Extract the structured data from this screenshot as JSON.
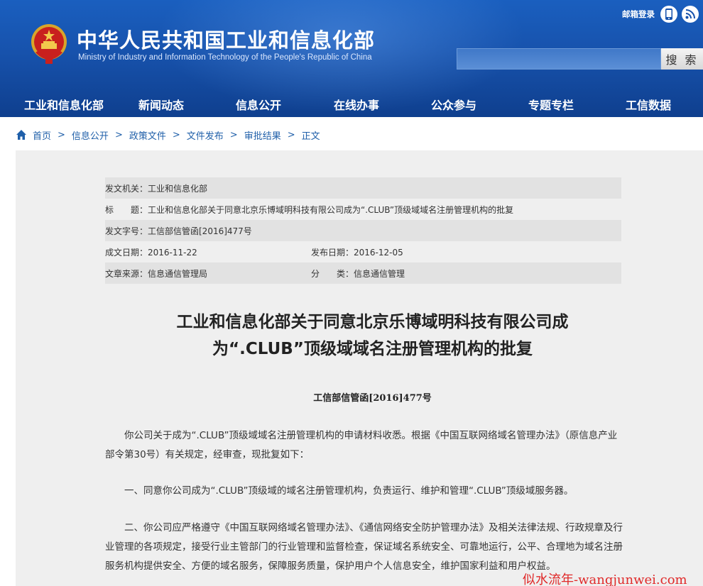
{
  "header": {
    "title": "中华人民共和国工业和信息化部",
    "subtitle": "Ministry of Industry and Information Technology of the People's Republic of China",
    "mail_login": "邮箱登录",
    "search_button": "搜 索",
    "search_placeholder": ""
  },
  "nav": {
    "items": [
      "工业和信息化部",
      "新闻动态",
      "信息公开",
      "在线办事",
      "公众参与",
      "专题专栏",
      "工信数据"
    ]
  },
  "breadcrumb": {
    "items": [
      "首页",
      "信息公开",
      "政策文件",
      "文件发布",
      "审批结果",
      "正文"
    ],
    "separator": ">"
  },
  "meta": {
    "issuer": "发文机关：工业和信息化部",
    "subject": "标　　题：工业和信息化部关于同意北京乐博域明科技有限公司成为“.CLUB”顶级域域名注册管理机构的批复",
    "doc_no": "发文字号：工信部信管函[2016]477号",
    "created_date": "成文日期：2016-11-22",
    "published_date": "发布日期：2016-12-05",
    "source": "文章来源：信息通信管理局",
    "category": "分　　类：信息通信管理"
  },
  "document": {
    "title_line1": "工业和信息化部关于同意北京乐博域明科技有限公司成",
    "title_line2": "为“.CLUB”顶级域域名注册管理机构的批复",
    "number": "工信部信管函[2016]477号",
    "paragraphs": [
      "你公司关于成为“.CLUB”顶级域域名注册管理机构的申请材料收悉。根据《中国互联网络域名管理办法》（原信息产业部令第30号）有关规定，经审查，现批复如下：",
      "一、同意你公司成为“.CLUB”顶级域的域名注册管理机构，负责运行、维护和管理“.CLUB”顶级域服务器。",
      "二、你公司应严格遵守《中国互联网络域名管理办法》、《通信网络安全防护管理办法》及相关法律法规、行政规章及行业管理的各项规定，接受行业主管部门的行业管理和监督检查，保证域名系统安全、可靠地运行，公平、合理地为域名注册服务机构提供安全、方便的域名服务，保障服务质量，保护用户个人信息安全，维护国家利益和用户权益。"
    ]
  },
  "watermark": "似水流年-wangjunwei.com",
  "colors": {
    "header_blue": "#1752ac",
    "link_blue": "#1f5fa9",
    "content_bg": "#efefef",
    "meta_shade": "#e2e2e2",
    "watermark_red": "#e02a2a"
  },
  "icons": {
    "emblem": "national-emblem-icon",
    "phone": "mobile-phone-icon",
    "rss": "rss-icon",
    "home": "home-icon"
  }
}
